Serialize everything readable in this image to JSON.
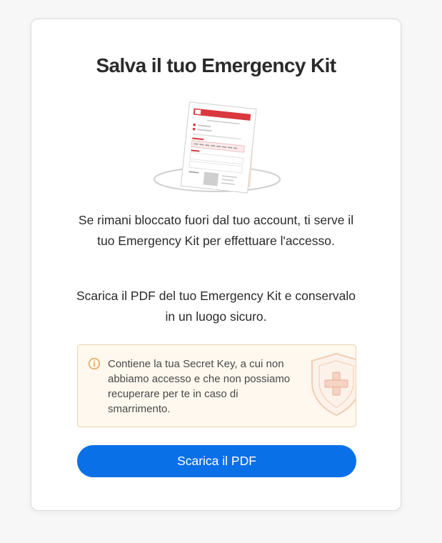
{
  "dialog": {
    "title": "Salva il tuo Emergency Kit",
    "paragraph_1": "Se rimani bloccato fuori dal tuo account, ti serve il tuo Emergency Kit per effettuare l'accesso.",
    "paragraph_2": "Scarica il PDF del tuo Emergency Kit e conservalo in un luogo sicuro.",
    "notice": {
      "icon": "info-icon",
      "text": "Contiene la tua Secret Key, a cui non abbiamo accesso e che non possiamo recuperare per te in caso di smarrimento.",
      "decoration_icon": "shield-cross-icon"
    },
    "download_button_label": "Scarica il PDF",
    "illustration_icon": "emergency-kit-document-icon"
  },
  "colors": {
    "background": "#f7f7f7",
    "card": "#ffffff",
    "primary_button": "#0a70e8",
    "notice_background": "#fef8ee",
    "notice_border": "#ecd3a8",
    "accent_red": "#d9383f"
  }
}
